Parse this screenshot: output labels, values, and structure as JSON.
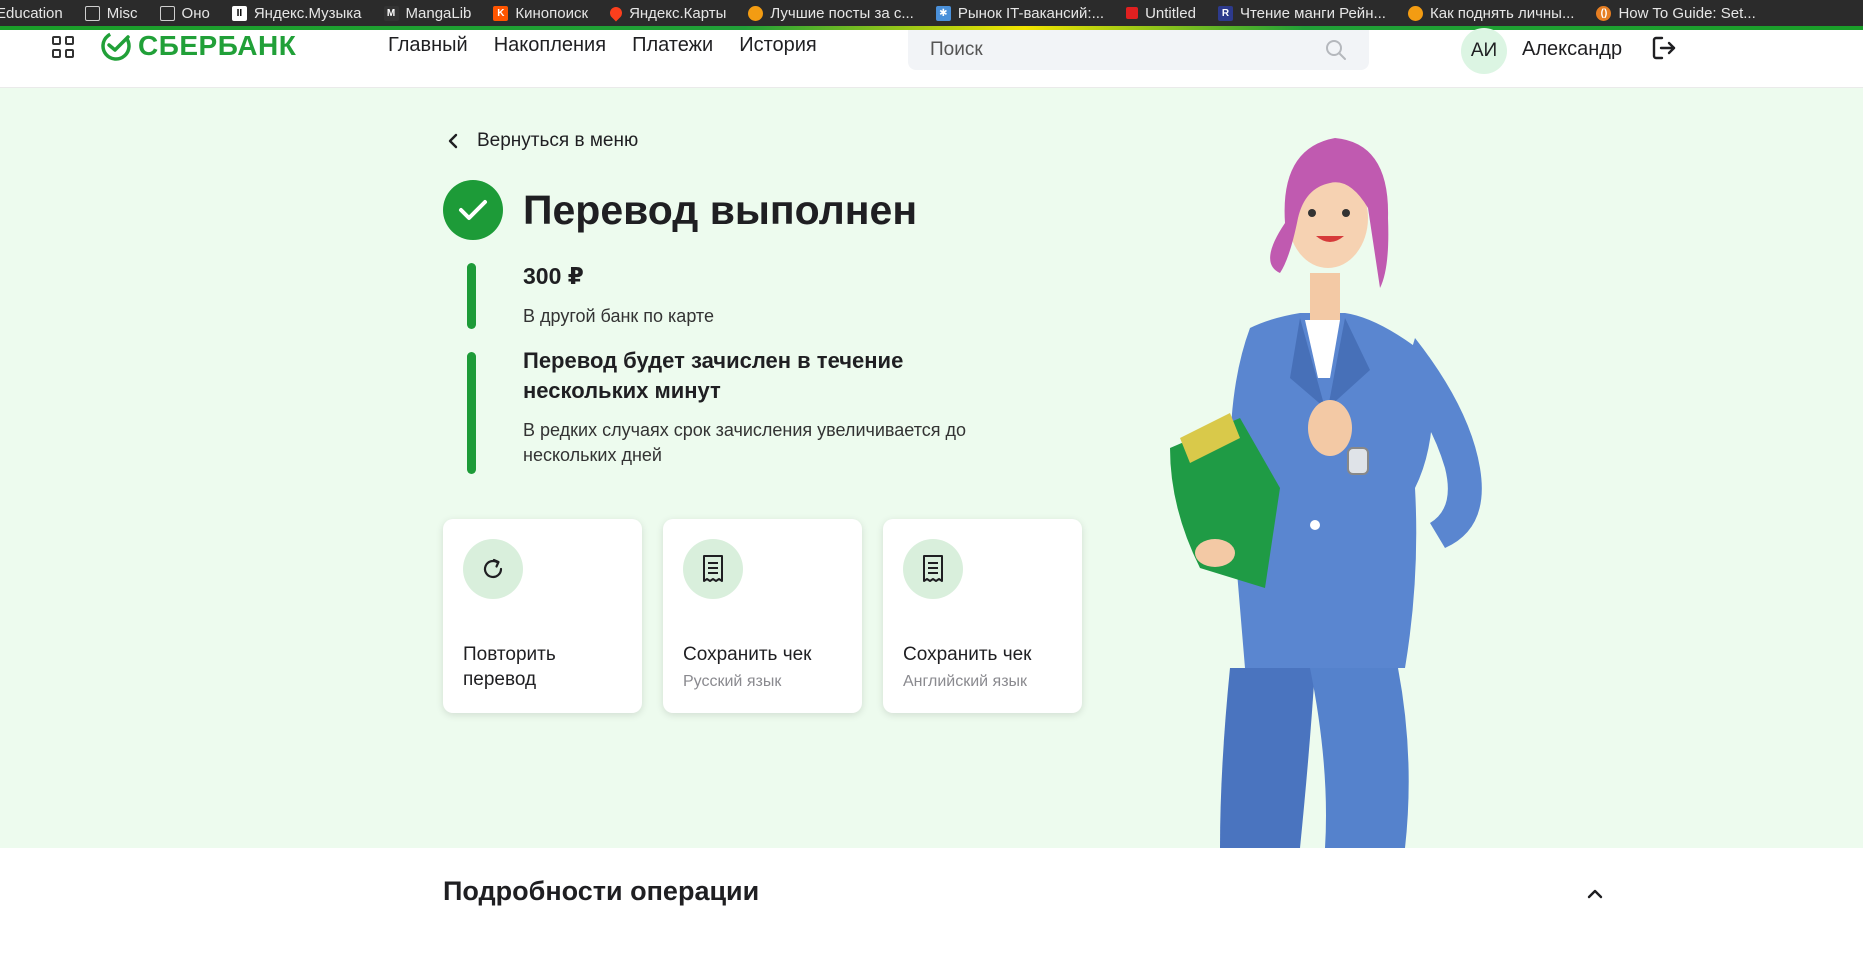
{
  "bookmarks": [
    {
      "label": "Education",
      "icon": "none"
    },
    {
      "label": "Misc",
      "icon": "folder-icon"
    },
    {
      "label": "Оно",
      "icon": "folder-icon"
    },
    {
      "label": "Яндекс.Музыка",
      "icon": "yandex-music-icon"
    },
    {
      "label": "MangaLib",
      "icon": "mangalib-icon"
    },
    {
      "label": "Кинопоиск",
      "icon": "kinopoisk-icon"
    },
    {
      "label": "Яндекс.Карты",
      "icon": "map-pin-icon"
    },
    {
      "label": "Лучшие посты за с...",
      "icon": "pikabu-icon"
    },
    {
      "label": "Рынок IT-вакансий:...",
      "icon": "it-market-icon"
    },
    {
      "label": "Untitled",
      "icon": "red-square-icon"
    },
    {
      "label": "Чтение манги Рейн...",
      "icon": "manga-reader-icon"
    },
    {
      "label": "Как поднять личны...",
      "icon": "pikabu-icon"
    },
    {
      "label": "How To Guide: Set...",
      "icon": "guide-icon"
    }
  ],
  "colors": {
    "brand": "#21a038",
    "success": "#1d9b38",
    "hero_bg": "#edfbee",
    "icon_bg": "#d9efdc",
    "avatar_bg": "#dcf5e3"
  },
  "header": {
    "logo_text": "СБЕРБАНК",
    "nav": [
      "Главный",
      "Накопления",
      "Платежи",
      "История"
    ],
    "search_placeholder": "Поиск",
    "avatar_initials": "АИ",
    "username": "Александр"
  },
  "hero": {
    "back_label": "Вернуться в меню",
    "title": "Перевод выполнен",
    "amount": "300 ₽",
    "amount_description": "В другой банк по карте",
    "notice_title": "Перевод будет зачислен в течение нескольких минут",
    "notice_description": "В редких случаях срок зачисления увеличивается до нескольких дней",
    "actions": [
      {
        "label": "Повторить перевод",
        "sub": "",
        "icon": "repeat-icon"
      },
      {
        "label": "Сохранить чек",
        "sub": "Русский язык",
        "icon": "receipt-icon"
      },
      {
        "label": "Сохранить чек",
        "sub": "Английский язык",
        "icon": "receipt-icon"
      }
    ]
  },
  "details": {
    "title": "Подробности операции"
  }
}
